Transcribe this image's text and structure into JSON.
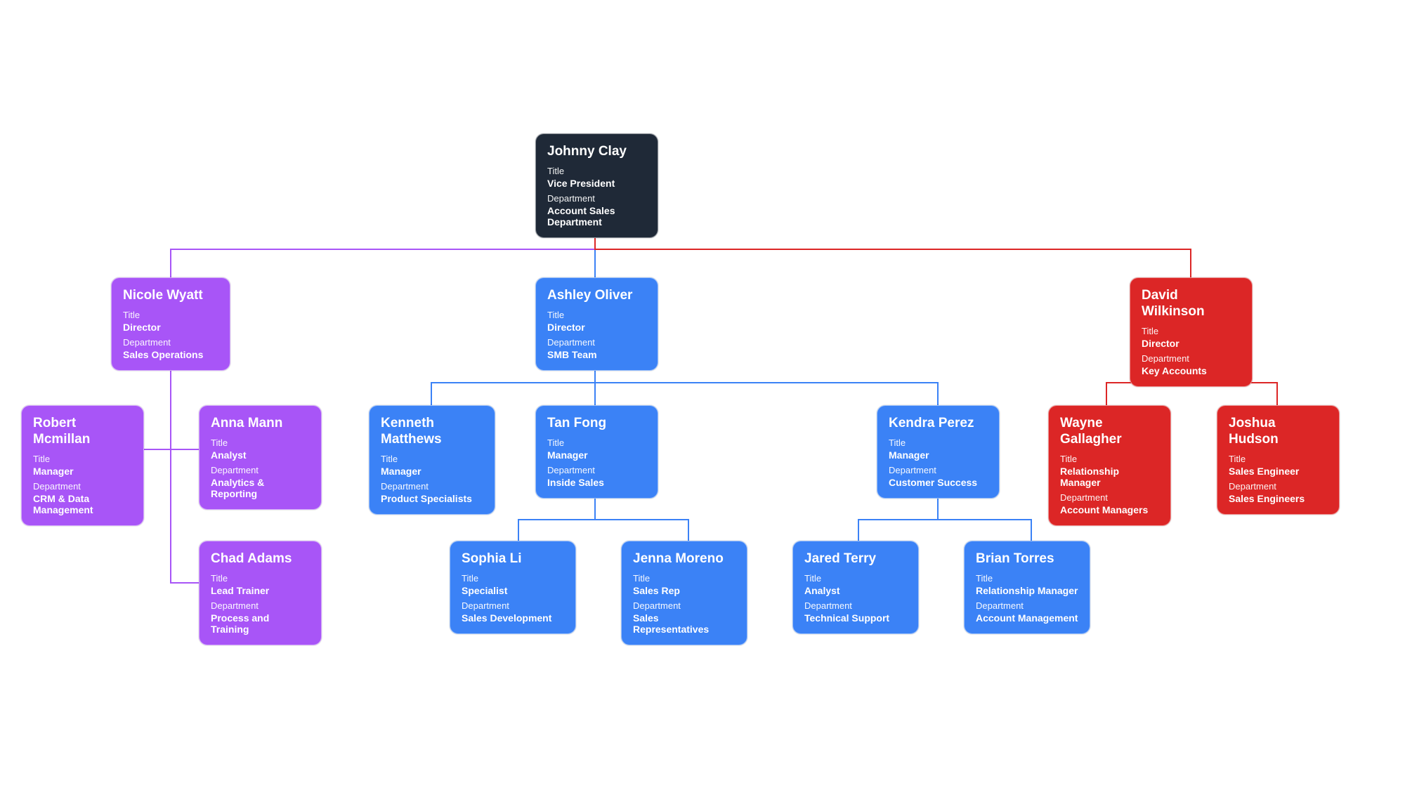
{
  "labels": {
    "title": "Title",
    "department": "Department"
  },
  "colors": {
    "dark": "#1f2937",
    "purple": "#a855f7",
    "blue": "#3b82f6",
    "red": "#dc2626"
  },
  "chart_data": {
    "type": "org-chart",
    "root": {
      "name": "Johnny Clay",
      "title": "Vice President",
      "department": "Account Sales Department",
      "color": "dark",
      "children": [
        {
          "name": "Nicole Wyatt",
          "title": "Director",
          "department": "Sales Operations",
          "color": "purple",
          "children": [
            {
              "name": "Robert Mcmillan",
              "title": "Manager",
              "department": "CRM & Data Management",
              "color": "purple"
            },
            {
              "name": "Anna Mann",
              "title": "Analyst",
              "department": "Analytics & Reporting",
              "color": "purple"
            },
            {
              "name": "Chad Adams",
              "title": "Lead Trainer",
              "department": "Process and Training",
              "color": "purple"
            }
          ]
        },
        {
          "name": "Ashley Oliver",
          "title": "Director",
          "department": "SMB Team",
          "color": "blue",
          "children": [
            {
              "name": "Kenneth Matthews",
              "title": "Manager",
              "department": "Product Specialists",
              "color": "blue"
            },
            {
              "name": "Tan Fong",
              "title": "Manager",
              "department": "Inside Sales",
              "color": "blue",
              "children": [
                {
                  "name": "Sophia Li",
                  "title": "Specialist",
                  "department": "Sales Development",
                  "color": "blue"
                },
                {
                  "name": "Jenna Moreno",
                  "title": "Sales Rep",
                  "department": "Sales Representatives",
                  "color": "blue"
                }
              ]
            },
            {
              "name": "Kendra Perez",
              "title": "Manager",
              "department": "Customer Success",
              "color": "blue",
              "children": [
                {
                  "name": "Jared Terry",
                  "title": "Analyst",
                  "department": "Technical Support",
                  "color": "blue"
                },
                {
                  "name": "Brian Torres",
                  "title": "Relationship Manager",
                  "department": "Account Management",
                  "color": "blue"
                }
              ]
            }
          ]
        },
        {
          "name": "David Wilkinson",
          "title": "Director",
          "department": "Key Accounts",
          "color": "red",
          "children": [
            {
              "name": "Wayne Gallagher",
              "title": "Relationship Manager",
              "department": "Account Managers",
              "color": "red"
            },
            {
              "name": "Joshua Hudson",
              "title": "Sales Engineer",
              "department": "Sales Engineers",
              "color": "red"
            }
          ]
        }
      ]
    }
  },
  "nodes": {
    "johnny": {
      "name": "Johnny Clay",
      "title": "Vice President",
      "department": "Account Sales Department"
    },
    "nicole": {
      "name": "Nicole Wyatt",
      "title": "Director",
      "department": "Sales Operations"
    },
    "ashley": {
      "name": "Ashley Oliver",
      "title": "Director",
      "department": "SMB Team"
    },
    "david": {
      "name": "David Wilkinson",
      "title": "Director",
      "department": "Key Accounts"
    },
    "robert": {
      "name": "Robert Mcmillan",
      "title": "Manager",
      "department": "CRM & Data Management"
    },
    "anna": {
      "name": "Anna Mann",
      "title": "Analyst",
      "department": "Analytics & Reporting"
    },
    "chad": {
      "name": "Chad Adams",
      "title": "Lead Trainer",
      "department": "Process and Training"
    },
    "kenneth": {
      "name": "Kenneth Matthews",
      "title": "Manager",
      "department": "Product Specialists"
    },
    "tan": {
      "name": "Tan Fong",
      "title": "Manager",
      "department": "Inside Sales"
    },
    "kendra": {
      "name": "Kendra Perez",
      "title": "Manager",
      "department": "Customer Success"
    },
    "wayne": {
      "name": "Wayne Gallagher",
      "title": "Relationship Manager",
      "department": "Account Managers"
    },
    "joshua": {
      "name": "Joshua Hudson",
      "title": "Sales Engineer",
      "department": "Sales Engineers"
    },
    "sophia": {
      "name": "Sophia Li",
      "title": "Specialist",
      "department": "Sales Development"
    },
    "jenna": {
      "name": "Jenna Moreno",
      "title": "Sales Rep",
      "department": "Sales Representatives"
    },
    "jared": {
      "name": "Jared Terry",
      "title": "Analyst",
      "department": "Technical Support"
    },
    "brian": {
      "name": "Brian Torres",
      "title": "Relationship Manager",
      "department": "Account Management"
    }
  }
}
